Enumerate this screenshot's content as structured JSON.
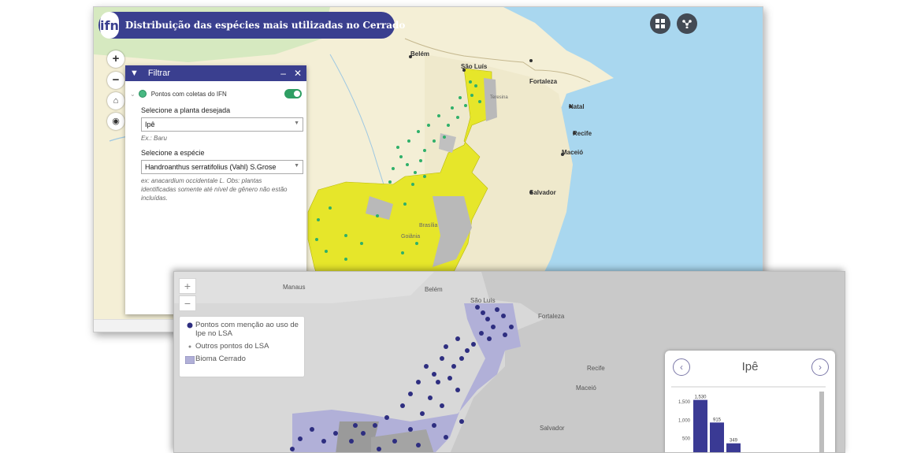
{
  "top": {
    "title": "Distribuição das espécies mais utilizadas no Cerrado",
    "logo_text": "ifn",
    "map_labels": [
      "Belém",
      "São Luís",
      "Fortaleza",
      "Natal",
      "Recife",
      "Maceió",
      "Salvador",
      "Brasília",
      "Goiânia",
      "Teresina"
    ],
    "zoom_in": "+",
    "zoom_out": "−",
    "filter": {
      "title": "Filtrar",
      "minimize": "–",
      "close": "✕",
      "layer_label": "Pontos com coletas do IFN",
      "plant_label": "Selecione a planta desejada",
      "plant_value": "Ipê",
      "plant_hint": "Ex.: Baru",
      "species_label": "Selecione a espécie",
      "species_value": "Handroanthus serratifolius (Vahl) S.Grose",
      "species_hint": "ex: anacardium occidentale L. Obs: plantas identificadas somente até nível de gênero não estão incluídas."
    },
    "colors": {
      "cerrado": "#e6e62a",
      "points": "#2fb06a",
      "header": "#3a3f8f"
    }
  },
  "bottom": {
    "map_labels": [
      "Manaus",
      "Belém",
      "São Luís",
      "Fortaleza",
      "Recife",
      "Maceió",
      "Salvador"
    ],
    "zoom_in": "+",
    "zoom_out": "−",
    "legend": [
      {
        "label": "Pontos com menção ao uso de Ipe no LSA",
        "symbol": "dark-dot"
      },
      {
        "label": "Outros pontos do LSA",
        "symbol": "small-dot"
      },
      {
        "label": "Bioma Cerrado",
        "symbol": "lavender-square"
      }
    ],
    "chart": {
      "title": "Ipê",
      "prev": "‹",
      "next": "›"
    },
    "colors": {
      "points": "#2e2e80",
      "cerrado": "#b1b0d8"
    }
  },
  "chart_data": {
    "type": "bar",
    "title": "Ipê",
    "ytick_labels": [
      "500",
      "1,000",
      "1,500"
    ],
    "values": [
      1530,
      915,
      349
    ],
    "data_labels": [
      "1,530",
      "915",
      "349"
    ]
  }
}
